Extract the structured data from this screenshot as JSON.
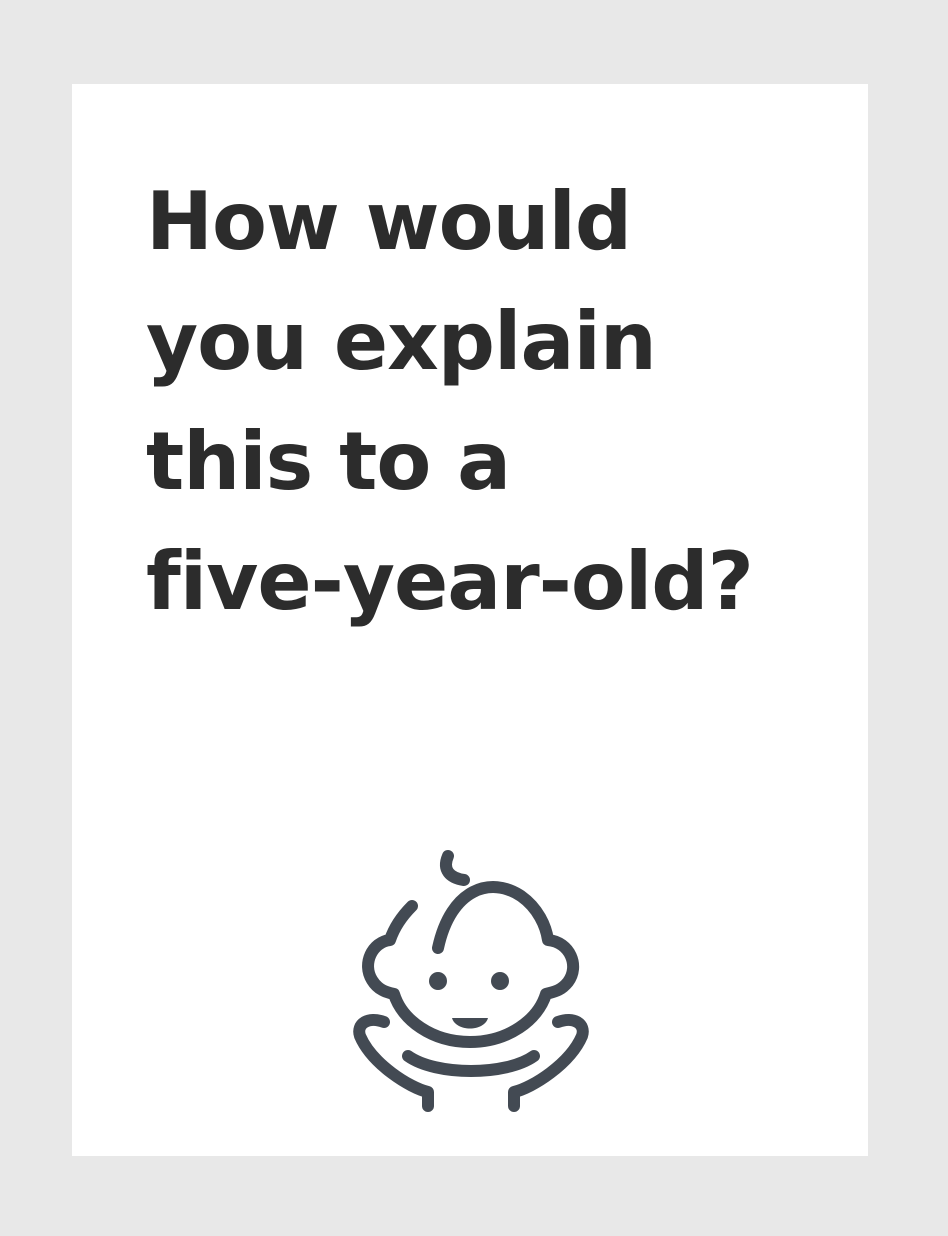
{
  "card": {
    "question_lines": [
      "How would",
      "you explain",
      "this to a",
      "five-year-old?"
    ],
    "icon": "baby-face-icon",
    "text_color": "#2c2c2c",
    "icon_color": "#434a53",
    "background_color": "#e8e8e8"
  }
}
